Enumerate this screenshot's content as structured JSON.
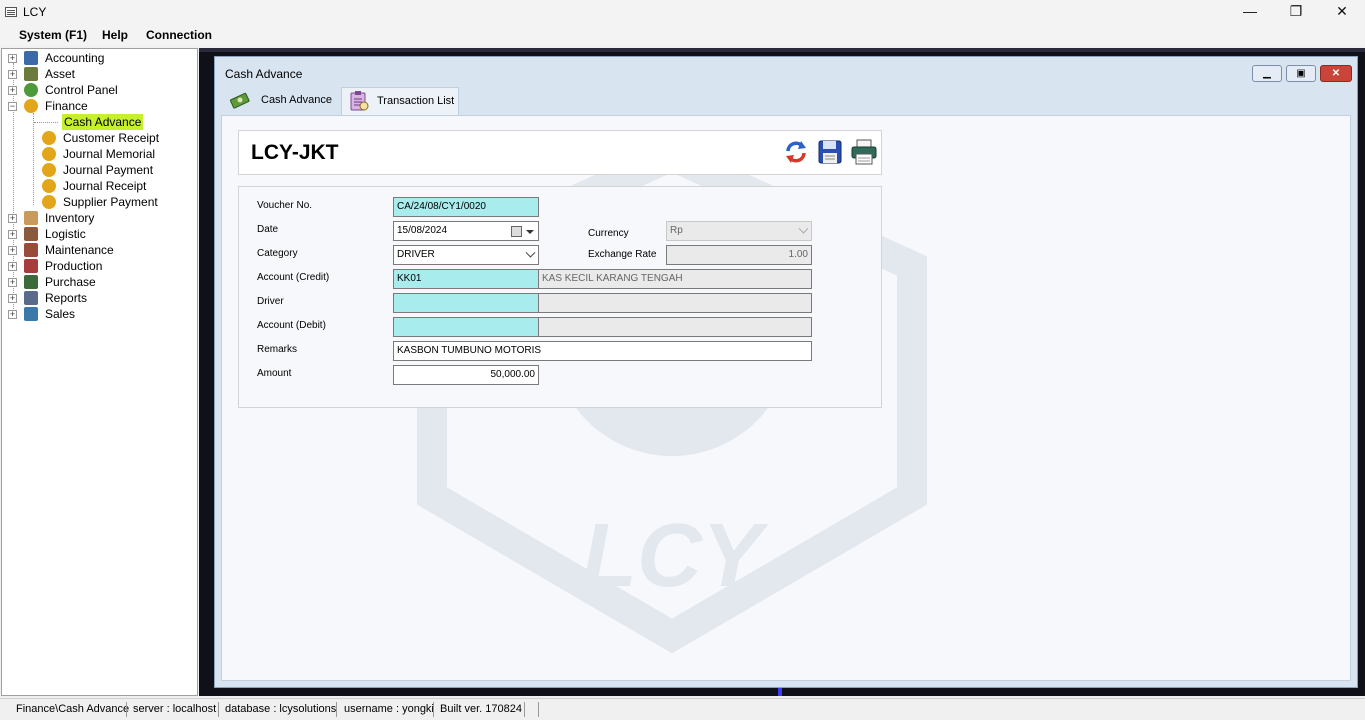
{
  "app": {
    "title": "LCY",
    "minimize": "—",
    "restore": "❐",
    "close": "✕"
  },
  "menu": {
    "items": [
      "System (F1)",
      "Help",
      "Connection"
    ]
  },
  "tree": {
    "items": [
      {
        "label": "Accounting",
        "icon": "accounting-icon"
      },
      {
        "label": "Asset",
        "icon": "asset-icon"
      },
      {
        "label": "Control Panel",
        "icon": "control-panel-icon"
      },
      {
        "label": "Finance",
        "icon": "finance-icon"
      },
      {
        "label": "Cash Advance",
        "icon": "",
        "selected": true
      },
      {
        "label": "Customer Receipt",
        "icon": "money-bag-icon"
      },
      {
        "label": "Journal Memorial",
        "icon": "money-bag-icon"
      },
      {
        "label": "Journal Payment",
        "icon": "money-bag-icon"
      },
      {
        "label": "Journal Receipt",
        "icon": "money-bag-icon"
      },
      {
        "label": "Supplier Payment",
        "icon": "money-bag-icon"
      },
      {
        "label": "Inventory",
        "icon": "inventory-icon"
      },
      {
        "label": "Logistic",
        "icon": "logistic-icon"
      },
      {
        "label": "Maintenance",
        "icon": "maintenance-icon"
      },
      {
        "label": "Production",
        "icon": "production-icon"
      },
      {
        "label": "Purchase",
        "icon": "purchase-icon"
      },
      {
        "label": "Reports",
        "icon": "reports-icon"
      },
      {
        "label": "Sales",
        "icon": "sales-icon"
      }
    ]
  },
  "window": {
    "title": "Cash Advance",
    "tabs": [
      {
        "label": "Cash Advance",
        "icon": "cash-icon"
      },
      {
        "label": "Transaction List",
        "icon": "clipboard-list-icon"
      }
    ],
    "company": "LCY-JKT",
    "watermark": "LCY"
  },
  "form": {
    "voucher_label": "Voucher No.",
    "voucher_value": "CA/24/08/CY1/0020",
    "date_label": "Date",
    "date_value": "15/08/2024",
    "category_label": "Category",
    "category_value": "DRIVER",
    "account_credit_label": "Account (Credit)",
    "account_credit_code": "KK01",
    "account_credit_name": "KAS KECIL KARANG TENGAH",
    "driver_label": "Driver",
    "driver_code": "",
    "driver_name": "",
    "account_debit_label": "Account (Debit)",
    "account_debit_code": "",
    "account_debit_name": "",
    "remarks_label": "Remarks",
    "remarks_value": "KASBON TUMBUNO MOTORIS",
    "amount_label": "Amount",
    "amount_value": "50,000.00",
    "currency_label": "Currency",
    "currency_value": "Rp",
    "exchange_label": "Exchange Rate",
    "exchange_value": "1.00"
  },
  "status": {
    "path": "Finance\\Cash Advance",
    "server": "server : localhost",
    "database": "database : lcysolutions",
    "username": "username : yongki",
    "build": "Built ver. 170824"
  },
  "colors": {
    "selected": "#c6f02e",
    "cyan_field": "#a8ecee",
    "mdi_bg": "#101018"
  }
}
